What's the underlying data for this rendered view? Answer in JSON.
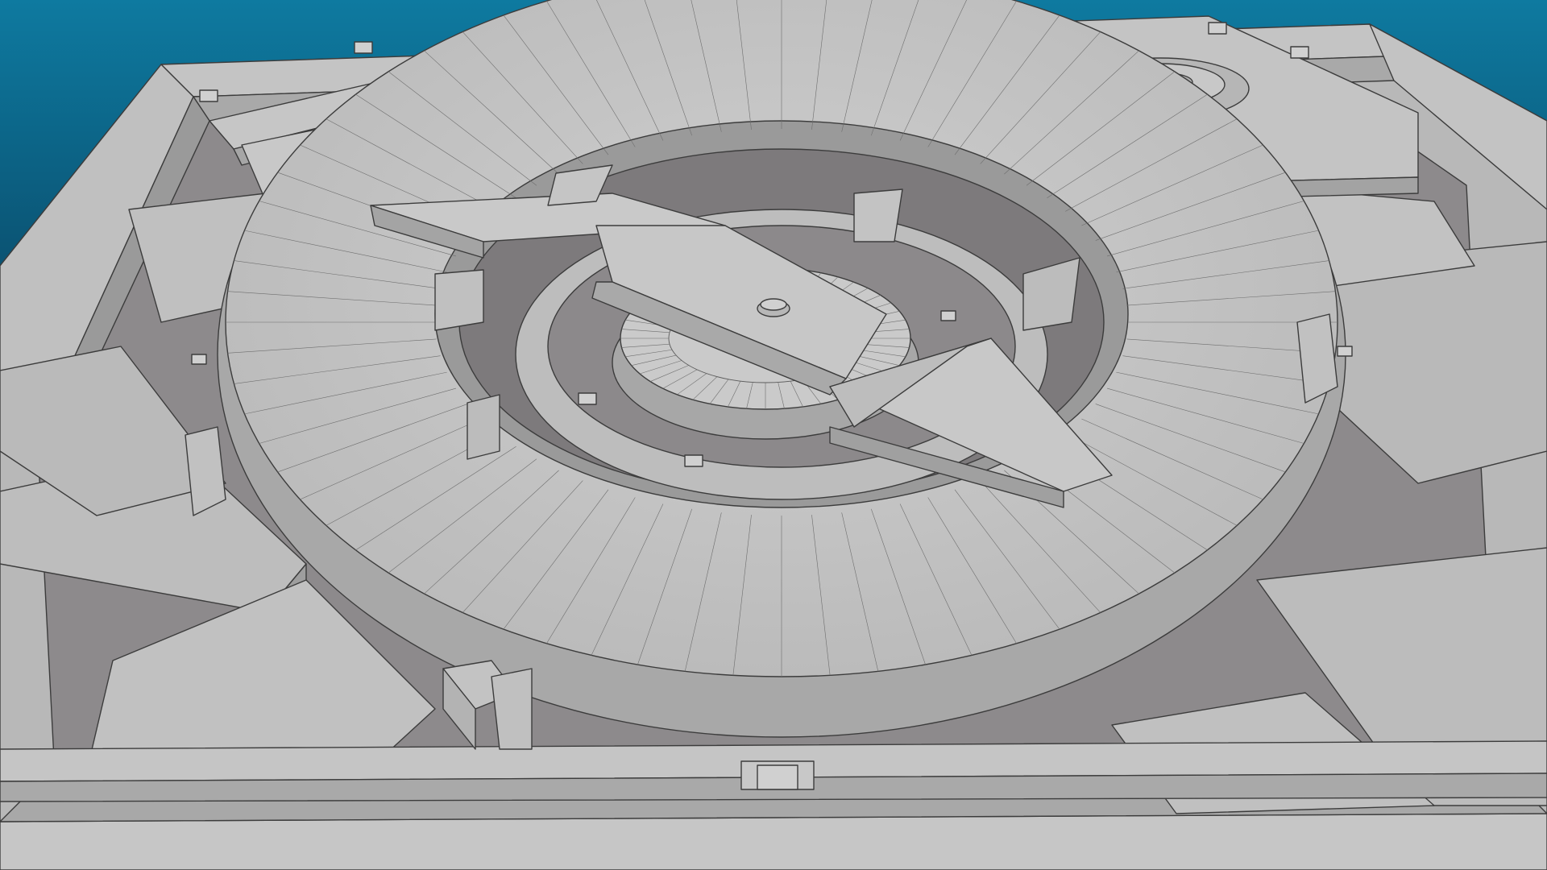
{
  "viewport": {
    "background_top": "#0e7aa0",
    "background_bottom": "#041e2c",
    "surface_light": "#c9c9c9",
    "surface_mid": "#b3b3b3",
    "surface_dark": "#8f8f8f",
    "surface_shadow": "#6a6668",
    "wire_color": "#3c3c3c"
  }
}
